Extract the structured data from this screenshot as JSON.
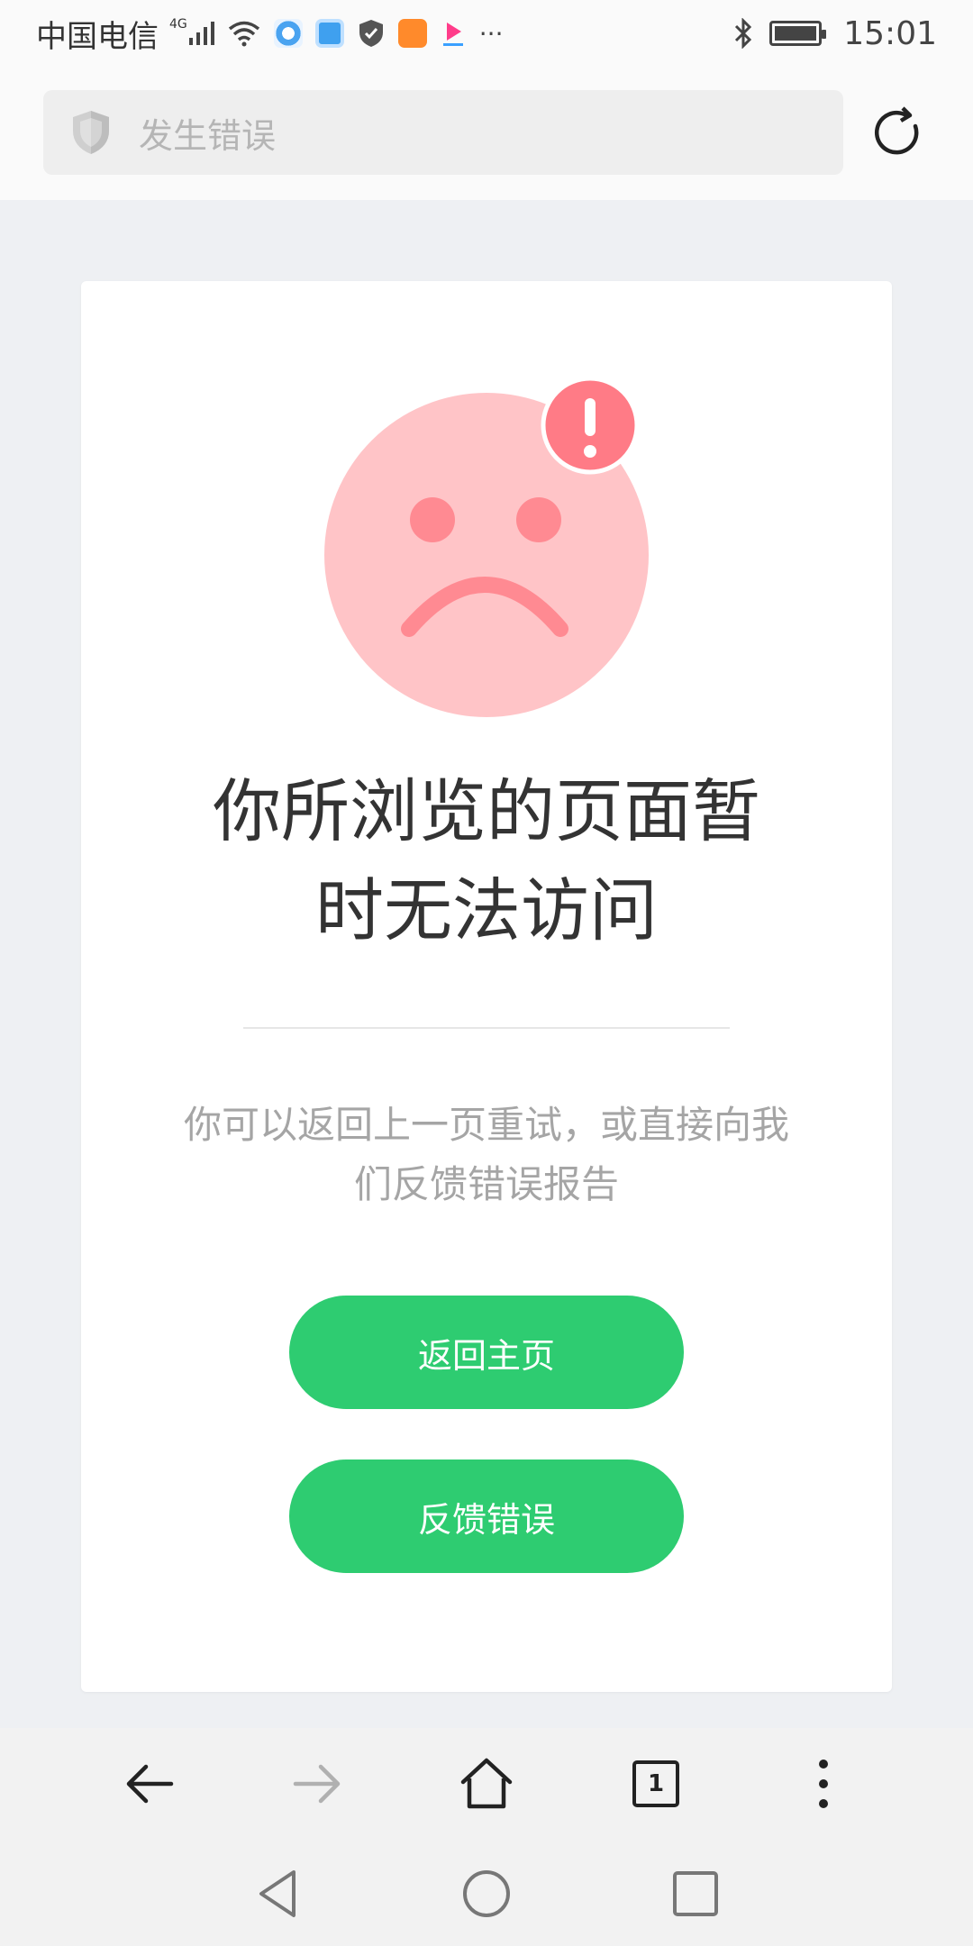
{
  "statusbar": {
    "carrier": "中国电信",
    "network": "4G",
    "time": "15:01",
    "more": "···",
    "icons": [
      "signal-icon",
      "wifi-icon",
      "app-icon-blue-circle",
      "app-icon-blue-square",
      "shield-icon",
      "app-icon-orange",
      "youku-icon",
      "bluetooth-icon",
      "battery-icon"
    ]
  },
  "address": {
    "title": "发生错误",
    "icon": "shield-icon"
  },
  "error": {
    "heading": "你所浏览的页面暂时无法访问",
    "description": "你可以返回上一页重试，或直接向我们反馈错误报告",
    "home_button": "返回主页",
    "feedback_button": "反馈错误"
  },
  "toolbar": {
    "tab_count": "1",
    "icons": [
      "back-arrow-icon",
      "forward-arrow-icon",
      "home-icon",
      "tabs-icon",
      "more-vertical-icon"
    ]
  },
  "colors": {
    "accent": "#2ecc71",
    "face": "#ffc4c7",
    "face_features": "#ff8a92",
    "alert": "#ff7b86"
  }
}
